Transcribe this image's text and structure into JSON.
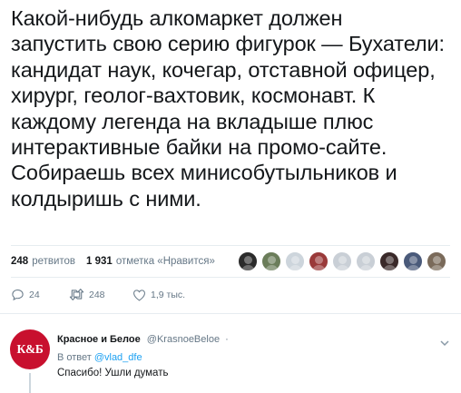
{
  "tweet": {
    "text": "Какой-нибудь алкомаркет должен\nзапустить свою серию фигурок — Бухатели:\nкандидат наук, кочегар, отставной офицер,\nхирург, геолог-вахтовик, космонавт. К\nкаждому легенда на вкладыше плюс\nинтерактивные байки на промо-сайте.\nСобираешь всех минисобутыльников и\nколдыришь с ними."
  },
  "stats": {
    "retweets_count": "248",
    "retweets_label": "ретвитов",
    "likes_count": "1 931",
    "likes_label": "отметка «Нравится»"
  },
  "likers": [
    {
      "name": "liker-avatar-1",
      "color": "#2b2b2b"
    },
    {
      "name": "liker-avatar-2",
      "color": "#6b7d5a"
    },
    {
      "name": "liker-avatar-3",
      "color": "#cdd5dc"
    },
    {
      "name": "liker-avatar-4",
      "color": "#9a3a3a"
    },
    {
      "name": "liker-avatar-5",
      "color": "#c9cfd6"
    },
    {
      "name": "liker-avatar-6",
      "color": "#c9cfd6"
    },
    {
      "name": "liker-avatar-7",
      "color": "#3a2a2a"
    },
    {
      "name": "liker-avatar-8",
      "color": "#4a5a7a"
    },
    {
      "name": "liker-avatar-9",
      "color": "#7a6a5a"
    }
  ],
  "actions": {
    "replies": "24",
    "retweets": "248",
    "likes": "1,9 тыс."
  },
  "reply": {
    "avatar_text": "К&Б",
    "name": "Красное и Белое",
    "handle": "@KrasnoeBeloe",
    "dot": "·",
    "reply_to_label": "В ответ",
    "reply_to_mention": "@vlad_dfe",
    "text": "Спасибо! Ушли думать"
  },
  "colors": {
    "text": "#14171a",
    "secondary": "#657786",
    "link": "#1da1f2",
    "divider": "#e6ecf0",
    "brand_red": "#c8102e"
  }
}
